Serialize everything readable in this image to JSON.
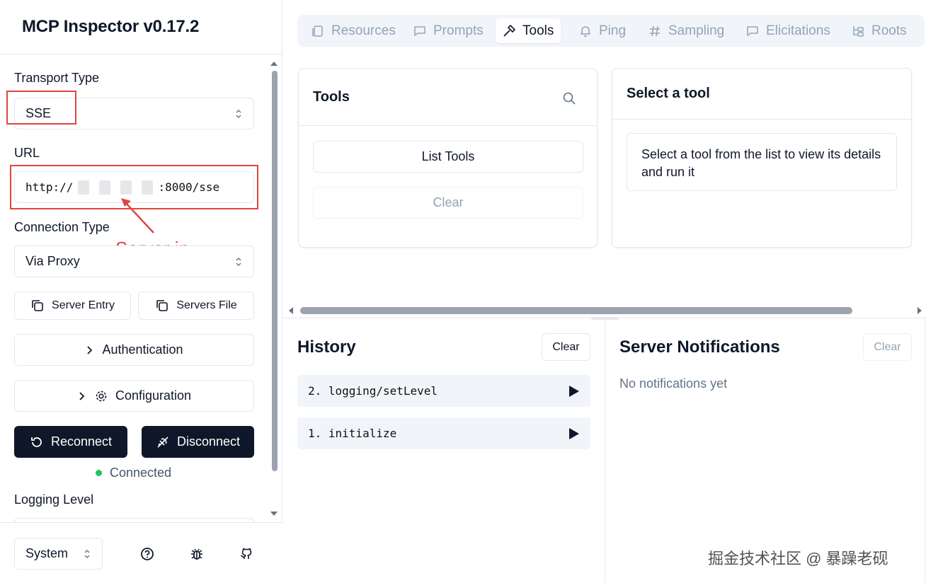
{
  "app": {
    "title": "MCP Inspector v0.17.2"
  },
  "sidebar": {
    "transport_label": "Transport Type",
    "transport_value": "SSE",
    "url_label": "URL",
    "url_prefix": "http://",
    "url_suffix": ":8000/sse",
    "connection_label": "Connection Type",
    "connection_value": "Via Proxy",
    "server_entry_label": "Server Entry",
    "servers_file_label": "Servers File",
    "authentication_label": "Authentication",
    "configuration_label": "Configuration",
    "reconnect_label": "Reconnect",
    "disconnect_label": "Disconnect",
    "status_text": "Connected",
    "logging_label": "Logging Level",
    "theme_value": "System"
  },
  "annotation": {
    "text": "Server ip"
  },
  "tabs": [
    {
      "label": "Resources",
      "icon": "file-icon"
    },
    {
      "label": "Prompts",
      "icon": "message-icon"
    },
    {
      "label": "Tools",
      "icon": "hammer-icon"
    },
    {
      "label": "Ping",
      "icon": "bell-icon"
    },
    {
      "label": "Sampling",
      "icon": "hash-icon"
    },
    {
      "label": "Elicitations",
      "icon": "message-square-icon"
    },
    {
      "label": "Roots",
      "icon": "folder-tree-icon"
    }
  ],
  "active_tab": "Tools",
  "tools_panel": {
    "title": "Tools",
    "list_button": "List Tools",
    "clear_button": "Clear"
  },
  "detail_panel": {
    "title": "Select a tool",
    "message": "Select a tool from the list to view its details and run it"
  },
  "history": {
    "title": "History",
    "clear_button": "Clear",
    "items": [
      {
        "label": "2. logging/setLevel"
      },
      {
        "label": "1. initialize"
      }
    ]
  },
  "notifications": {
    "title": "Server Notifications",
    "clear_button": "Clear",
    "empty_text": "No notifications yet"
  },
  "watermark": "掘金技术社区 @ 暴躁老砚",
  "colors": {
    "accent_dark": "#0f172a",
    "connected": "#22c55e",
    "annotation": "#e0453d"
  }
}
